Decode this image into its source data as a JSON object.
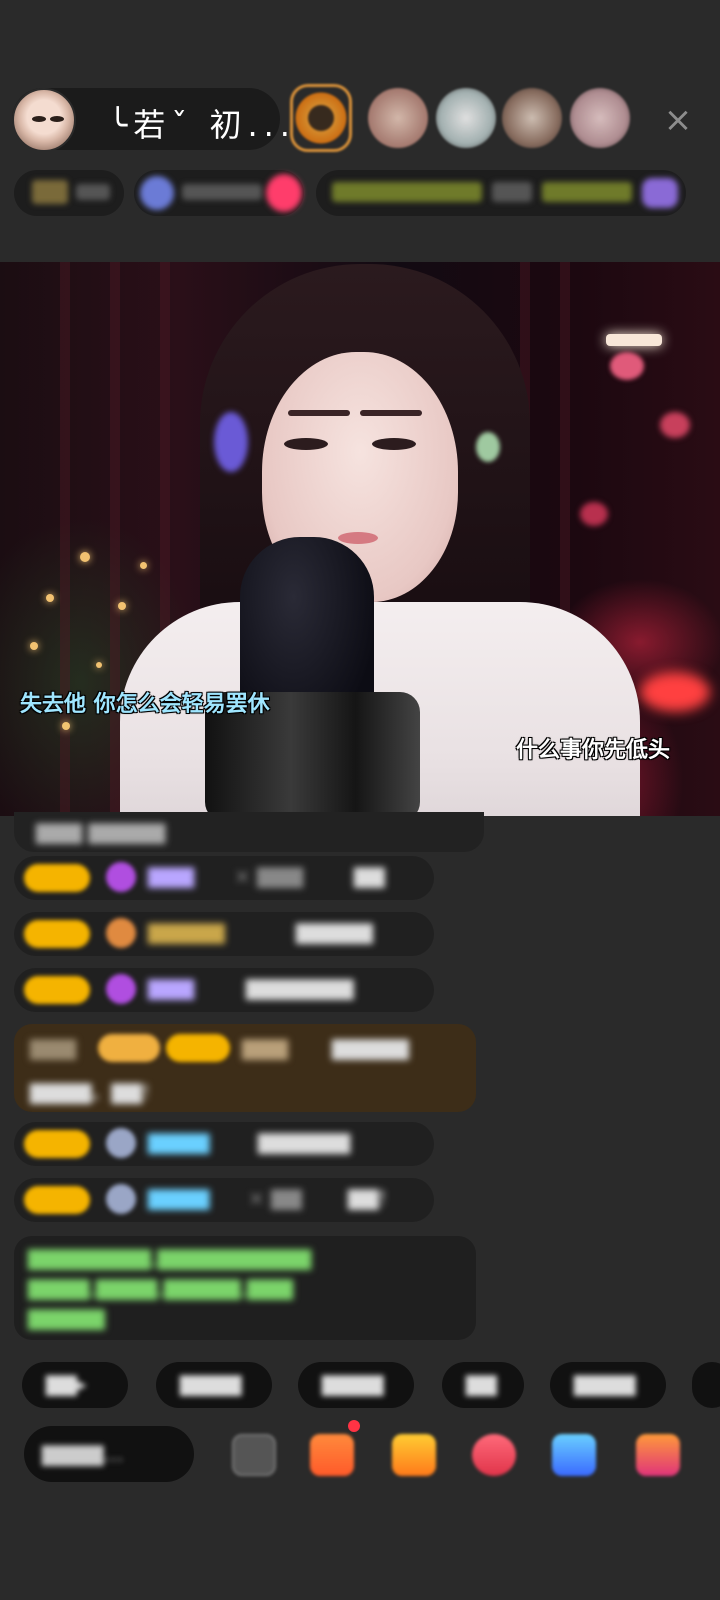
{
  "host": {
    "name": "╰若ˇ 初...",
    "follow_label": ""
  },
  "header": {
    "close_icon": "close-icon",
    "stats": [
      "",
      "",
      ""
    ],
    "ticker": ""
  },
  "video": {
    "lyric_left": "失去他  你怎么会轻易罢休",
    "lyric_right": "什么事你先低头"
  },
  "chat": {
    "messages": [
      {
        "user": "",
        "text": ""
      },
      {
        "user": "",
        "text": ""
      },
      {
        "user": "",
        "text": ""
      },
      {
        "user": "",
        "text": ""
      },
      {
        "user": "",
        "text": ""
      },
      {
        "user": "",
        "text": ""
      },
      {
        "user": "",
        "text": ""
      }
    ]
  },
  "colors": {
    "badge": "#f5b400",
    "lyric": "#9fe6ff",
    "notice_bg": "#3d2d18",
    "system_text": "#7bd46a"
  },
  "bottom": {
    "chips": [
      "",
      "",
      "",
      "",
      ""
    ],
    "say_placeholder": "",
    "tools": [
      "more-icon",
      "gift-box-icon",
      "gift-icon",
      "game-icon",
      "share-icon",
      "shop-icon"
    ]
  }
}
